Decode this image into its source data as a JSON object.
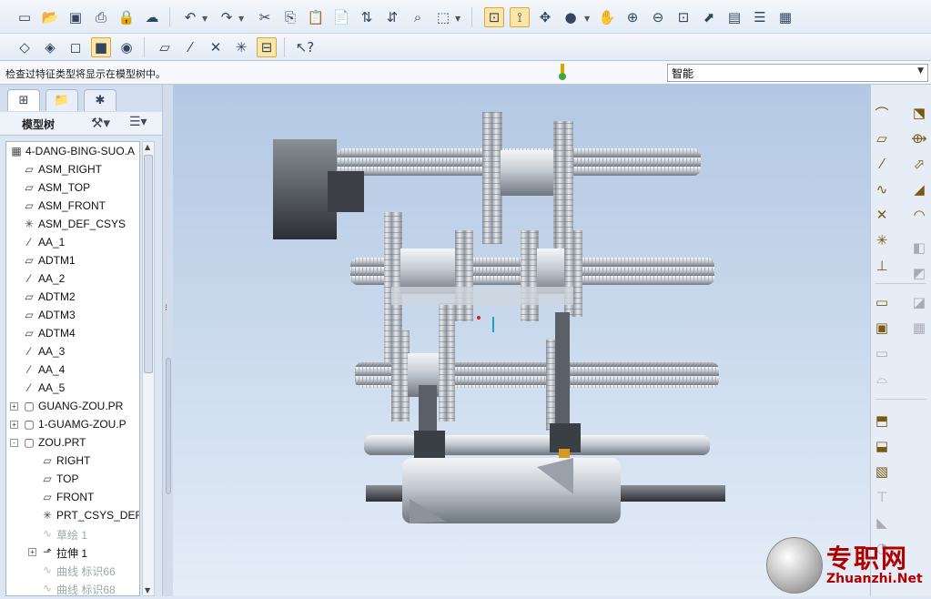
{
  "toolbar1": {
    "icons": [
      "new-icon",
      "open-icon",
      "save-icon",
      "print-icon",
      "lock-icon",
      "connection-icon",
      "undo-icon",
      "redo-icon",
      "cut-icon",
      "copy-icon",
      "paste-icon",
      "paste-special-icon",
      "regenerate-icon",
      "regen-manager-icon",
      "find-icon",
      "select-box-icon",
      "spin-center-icon",
      "view-orient-icon",
      "csys-toggle-icon",
      "shading-icon",
      "pan-icon",
      "zoom-in-icon",
      "zoom-out-icon",
      "refit-icon",
      "reorient-icon",
      "saved-views-icon",
      "layers-icon",
      "view-manager-icon"
    ]
  },
  "toolbar2": {
    "icons": [
      "wireframe-icon",
      "hidden-line-icon",
      "no-hidden-icon",
      "shaded-icon",
      "enhanced-realism-icon",
      "datum-plane-display-icon",
      "datum-axis-display-icon",
      "datum-point-display-icon",
      "csys-display-icon",
      "annotation-display-icon",
      "whats-this-icon"
    ]
  },
  "message": "检查过特征类型将显示在模型树中。",
  "filter": {
    "value": "智能"
  },
  "left_panel": {
    "tabs": [
      "model-tree-tab",
      "folder-browser-tab",
      "favorites-tab"
    ],
    "tree_title": "模型树",
    "tree": [
      {
        "label": "4-DANG-BING-SUO.A",
        "icon": "assembly-icon",
        "indent": 0,
        "dim": false
      },
      {
        "label": "ASM_RIGHT",
        "icon": "datum-plane-icon",
        "indent": 1,
        "dim": false
      },
      {
        "label": "ASM_TOP",
        "icon": "datum-plane-icon",
        "indent": 1,
        "dim": false
      },
      {
        "label": "ASM_FRONT",
        "icon": "datum-plane-icon",
        "indent": 1,
        "dim": false
      },
      {
        "label": "ASM_DEF_CSYS",
        "icon": "csys-icon",
        "indent": 1,
        "dim": false
      },
      {
        "label": "AA_1",
        "icon": "datum-axis-icon",
        "indent": 1,
        "dim": false
      },
      {
        "label": "ADTM1",
        "icon": "datum-plane-icon",
        "indent": 1,
        "dim": false
      },
      {
        "label": "AA_2",
        "icon": "datum-axis-icon",
        "indent": 1,
        "dim": false
      },
      {
        "label": "ADTM2",
        "icon": "datum-plane-icon",
        "indent": 1,
        "dim": false
      },
      {
        "label": "ADTM3",
        "icon": "datum-plane-icon",
        "indent": 1,
        "dim": false
      },
      {
        "label": "ADTM4",
        "icon": "datum-plane-icon",
        "indent": 1,
        "dim": false
      },
      {
        "label": "AA_3",
        "icon": "datum-axis-icon",
        "indent": 1,
        "dim": false
      },
      {
        "label": "AA_4",
        "icon": "datum-axis-icon",
        "indent": 1,
        "dim": false
      },
      {
        "label": "AA_5",
        "icon": "datum-axis-icon",
        "indent": 1,
        "dim": false
      },
      {
        "label": "GUANG-ZOU.PR",
        "icon": "part-icon",
        "indent": 1,
        "dim": false,
        "expander": "+"
      },
      {
        "label": "1-GUAMG-ZOU.P",
        "icon": "part-icon",
        "indent": 1,
        "dim": false,
        "expander": "+"
      },
      {
        "label": "ZOU.PRT",
        "icon": "part-icon",
        "indent": 1,
        "dim": false,
        "expander": "-"
      },
      {
        "label": "RIGHT",
        "icon": "datum-plane-icon",
        "indent": 2,
        "dim": false
      },
      {
        "label": "TOP",
        "icon": "datum-plane-icon",
        "indent": 2,
        "dim": false
      },
      {
        "label": "FRONT",
        "icon": "datum-plane-icon",
        "indent": 2,
        "dim": false
      },
      {
        "label": "PRT_CSYS_DEF",
        "icon": "csys-icon",
        "indent": 2,
        "dim": false
      },
      {
        "label": "草绘 1",
        "icon": "sketch-icon",
        "indent": 2,
        "dim": true
      },
      {
        "label": "拉伸 1",
        "icon": "extrude-icon",
        "indent": 2,
        "dim": false,
        "expander": "+"
      },
      {
        "label": "曲线 标识66",
        "icon": "curve-icon",
        "indent": 2,
        "dim": true
      },
      {
        "label": "曲线 标识68",
        "icon": "curve-icon",
        "indent": 2,
        "dim": true
      }
    ]
  },
  "right_toolbar": {
    "icons": [
      "sketch-tool-icon",
      "plane-tool-icon",
      "axis-tool-icon",
      "curve-tool-icon",
      "point-tool-icon",
      "csys-tool-icon",
      "analysis-tool-icon",
      "copy-geom-icon",
      "move-feature-icon",
      "sweep-icon",
      "boundary-blend-icon",
      "mirror-icon",
      "merge-icon",
      "trim-icon",
      "pattern-icon",
      "place-component-icon",
      "create-component-icon",
      "package-icon",
      "repeat-icon",
      "assemble-icon",
      "explode-icon"
    ]
  },
  "watermark": {
    "cn": "专职网",
    "en": "Zhuanzhi.Net"
  },
  "colors": {
    "viewport_top": "#b4c8e3",
    "viewport_bottom": "#e5edf7",
    "accent": "#fbe6a8",
    "watermark": "#b00000"
  }
}
